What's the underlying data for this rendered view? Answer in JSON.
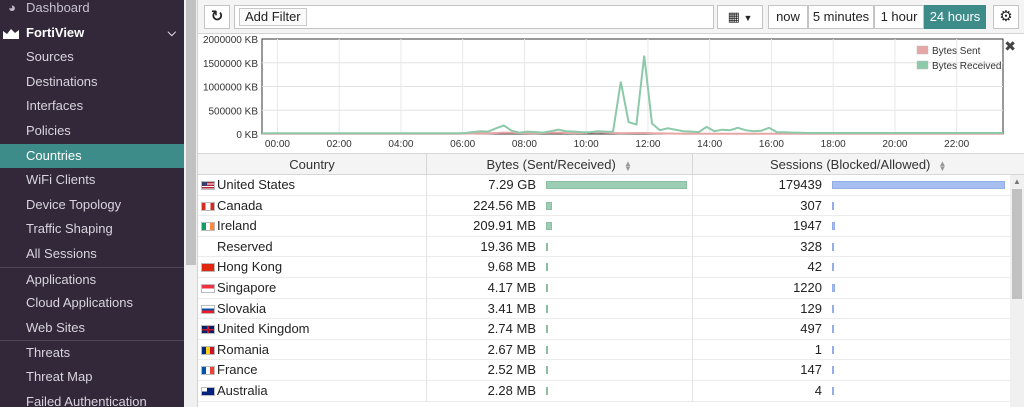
{
  "sidebar": {
    "dashboard": "Dashboard",
    "fortiview": "FortiView",
    "items": [
      {
        "label": "Sources"
      },
      {
        "label": "Destinations"
      },
      {
        "label": "Interfaces"
      },
      {
        "label": "Policies"
      },
      {
        "label": "Countries",
        "active": true
      },
      {
        "label": "WiFi Clients"
      },
      {
        "label": "Device Topology"
      },
      {
        "label": "Traffic Shaping"
      },
      {
        "label": "All Sessions"
      },
      {
        "label": "Applications",
        "sep": true
      },
      {
        "label": "Cloud Applications"
      },
      {
        "label": "Web Sites"
      },
      {
        "label": "Threats",
        "sep": true
      },
      {
        "label": "Threat Map"
      },
      {
        "label": "Failed Authentication"
      }
    ]
  },
  "toolbar": {
    "filter_label": "Add Filter",
    "time_ranges": [
      "now",
      "5 minutes",
      "1 hour",
      "24 hours"
    ],
    "active_range": "24 hours"
  },
  "chart_data": {
    "type": "line",
    "ylim": [
      0,
      2000000
    ],
    "yticks": [
      "2000000 KB",
      "1500000 KB",
      "1000000 KB",
      "500000 KB",
      "0 KB"
    ],
    "xticks": [
      "00:00",
      "02:00",
      "04:00",
      "06:00",
      "08:00",
      "10:00",
      "12:00",
      "14:00",
      "16:00",
      "18:00",
      "20:00",
      "22:00"
    ],
    "legend": "top-right",
    "series": [
      {
        "name": "Bytes Sent",
        "color": "#e7a6a6",
        "values": [
          5000,
          5000,
          5000,
          5000,
          5000,
          5000,
          5000,
          5000,
          5000,
          5000,
          5000,
          5000,
          5000,
          5000,
          5000,
          5000,
          5000,
          5000,
          5000,
          5000,
          5000,
          5000,
          5000,
          5000,
          5000,
          5000,
          8000,
          10000,
          15000,
          12000,
          20000,
          30000,
          25000,
          20000,
          18000,
          15000,
          20000,
          25000,
          30000,
          22000,
          18000,
          20000,
          30000,
          40000,
          25000,
          20000,
          15000,
          18000,
          22000,
          20000,
          15000,
          12000,
          10000,
          8000,
          7000,
          6000,
          6000,
          6000,
          6000,
          6000,
          6000,
          6000,
          6000,
          6000,
          6000,
          6000,
          6000,
          6000,
          6000,
          6000,
          6000,
          6000,
          6000,
          6000,
          6000,
          6000,
          6000,
          6000,
          6000,
          6000,
          6000,
          6000,
          6000,
          6000,
          6000,
          6000,
          6000,
          6000,
          6000,
          6000,
          6000,
          6000,
          6000,
          6000,
          6000,
          6000
        ]
      },
      {
        "name": "Bytes Received",
        "color": "#8cc9a9",
        "values": [
          15000,
          15000,
          15000,
          15000,
          15000,
          15000,
          15000,
          15000,
          15000,
          15000,
          15000,
          15000,
          15000,
          15000,
          15000,
          15000,
          15000,
          15000,
          15000,
          15000,
          15000,
          15000,
          15000,
          15000,
          15000,
          15000,
          20000,
          40000,
          60000,
          50000,
          120000,
          180000,
          70000,
          30000,
          50000,
          40000,
          30000,
          60000,
          90000,
          60000,
          50000,
          40000,
          35000,
          60000,
          50000,
          45000,
          1100000,
          250000,
          200000,
          1650000,
          220000,
          80000,
          120000,
          90000,
          60000,
          50000,
          40000,
          150000,
          60000,
          90000,
          80000,
          130000,
          80000,
          60000,
          70000,
          130000,
          40000,
          35000,
          30000,
          25000,
          20000,
          20000,
          20000,
          20000,
          20000,
          20000,
          20000,
          20000,
          20000,
          20000,
          20000,
          20000,
          20000,
          20000,
          20000,
          20000,
          20000,
          20000,
          20000,
          20000,
          20000,
          20000,
          20000,
          20000,
          20000,
          20000
        ]
      }
    ]
  },
  "table": {
    "headers": [
      "Country",
      "Bytes (Sent/Received)",
      "Sessions (Blocked/Allowed)"
    ],
    "rows": [
      {
        "country": "United States",
        "bytes": "7.29 GB",
        "bytes_frac": 1.0,
        "sessions": "179439",
        "sess_frac": 1.0,
        "flag": "us"
      },
      {
        "country": "Canada",
        "bytes": "224.56 MB",
        "bytes_frac": 0.04,
        "sessions": "307",
        "sess_frac": 0.005,
        "flag": "ca"
      },
      {
        "country": "Ireland",
        "bytes": "209.91 MB",
        "bytes_frac": 0.04,
        "sessions": "1947",
        "sess_frac": 0.015,
        "flag": "ie"
      },
      {
        "country": "Reserved",
        "bytes": "19.36 MB",
        "bytes_frac": 0.005,
        "sessions": "328",
        "sess_frac": 0.005,
        "flag": ""
      },
      {
        "country": "Hong Kong",
        "bytes": "9.68 MB",
        "bytes_frac": 0.005,
        "sessions": "42",
        "sess_frac": 0.005,
        "flag": "hk"
      },
      {
        "country": "Singapore",
        "bytes": "4.17 MB",
        "bytes_frac": 0.005,
        "sessions": "1220",
        "sess_frac": 0.015,
        "flag": "sg"
      },
      {
        "country": "Slovakia",
        "bytes": "3.41 MB",
        "bytes_frac": 0.005,
        "sessions": "129",
        "sess_frac": 0.005,
        "flag": "sk"
      },
      {
        "country": "United Kingdom",
        "bytes": "2.74 MB",
        "bytes_frac": 0.005,
        "sessions": "497",
        "sess_frac": 0.005,
        "flag": "gb"
      },
      {
        "country": "Romania",
        "bytes": "2.67 MB",
        "bytes_frac": 0.005,
        "sessions": "1",
        "sess_frac": 0.005,
        "flag": "ro"
      },
      {
        "country": "France",
        "bytes": "2.52 MB",
        "bytes_frac": 0.005,
        "sessions": "147",
        "sess_frac": 0.005,
        "flag": "fr"
      },
      {
        "country": "Australia",
        "bytes": "2.28 MB",
        "bytes_frac": 0.005,
        "sessions": "4",
        "sess_frac": 0.005,
        "flag": "au"
      }
    ]
  },
  "colors": {
    "sidebar_bg": "#32283a",
    "accent": "#3e8c8a",
    "bytes_bar": "#9ecdb5",
    "sessions_bar": "#a7bff0"
  }
}
